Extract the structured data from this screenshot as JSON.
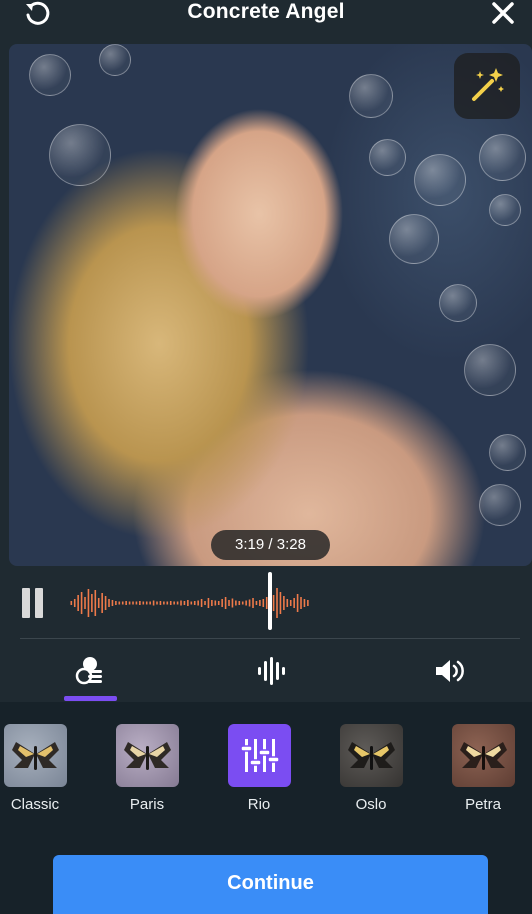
{
  "header": {
    "title": "Concrete Angel",
    "left_icon": "rotate-icon",
    "right_icon": "close-icon"
  },
  "video": {
    "time": "3:19 / 3:28",
    "magic_icon": "magic-wand-icon"
  },
  "player": {
    "pause_icon": "pause-icon",
    "progress": 0.957
  },
  "tabs": [
    {
      "name": "styles",
      "icon": "styles-icon",
      "active": true
    },
    {
      "name": "beat",
      "icon": "waveform-icon",
      "active": false
    },
    {
      "name": "volume",
      "icon": "volume-icon",
      "active": false
    }
  ],
  "styles": [
    {
      "label": "Classic",
      "tint": "#8b95a6"
    },
    {
      "label": "Paris",
      "tint": "#9b8fa8"
    },
    {
      "label": "Rio",
      "tint": "#7b4df2",
      "selected": true
    },
    {
      "label": "Oslo",
      "tint": "#4b4a48"
    },
    {
      "label": "Petra",
      "tint": "#7a5346"
    }
  ],
  "footer": {
    "continue_label": "Continue"
  },
  "colors": {
    "accent": "#7b4df2",
    "button": "#3a8df7",
    "waveform": "#ee7a4a"
  }
}
